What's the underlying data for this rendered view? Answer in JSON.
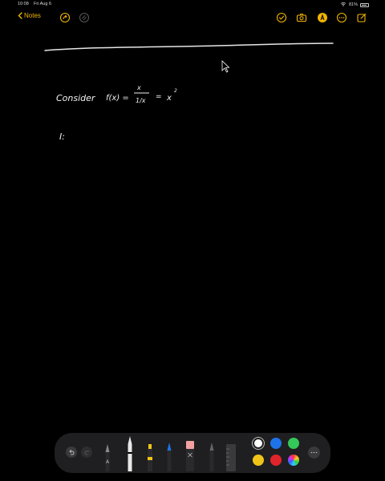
{
  "status_bar": {
    "time": "10:08",
    "date": "Fri Aug 6",
    "battery_text": "81%"
  },
  "toolbar": {
    "back_label": "Notes",
    "accent_color": "#f2b400",
    "left_icons": [
      "share-icon",
      "undo-circle-icon"
    ],
    "right_icons": [
      "checklist-icon",
      "camera-icon",
      "markup-icon",
      "more-circle-icon",
      "compose-icon"
    ]
  },
  "note": {
    "text_consider": "Consider",
    "text_fx": "f(x) =",
    "text_numerator": "x",
    "text_denominator": "1/x",
    "text_equals": "=",
    "text_x": "x",
    "text_exponent": "2",
    "text_next": "I:"
  },
  "palette": {
    "tools": [
      "pen-tool",
      "monoline-tool",
      "highlighter-tool",
      "fountain-pen-tool",
      "eraser-tool",
      "pencil-tool",
      "ruler-tool"
    ],
    "tool_label_pen": "A",
    "colors": [
      "#ffffff",
      "#1e73e8",
      "#34c759",
      "#f0c419",
      "#e0242c",
      "multicolor"
    ],
    "selected_color": "#ffffff"
  }
}
